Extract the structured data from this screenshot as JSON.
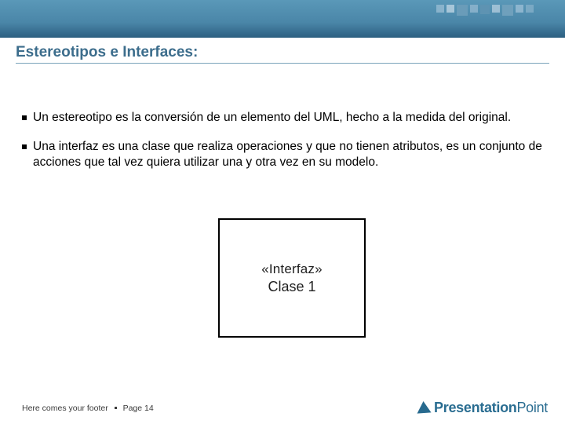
{
  "title": "Estereotipos e Interfaces:",
  "bullets": [
    "Un estereotipo es la conversión de un elemento del UML, hecho a la medida del original.",
    "Una interfaz es una clase que realiza operaciones y que no tienen atributos, es un conjunto de acciones que tal vez quiera utilizar una y otra vez en su modelo."
  ],
  "figure": {
    "line1": "«Interfaz»",
    "line2": "Clase 1"
  },
  "footer": {
    "text": "Here comes your footer",
    "page_label": "Page 14"
  },
  "logo": {
    "brand_a": "Presentation",
    "brand_b": "Point"
  }
}
